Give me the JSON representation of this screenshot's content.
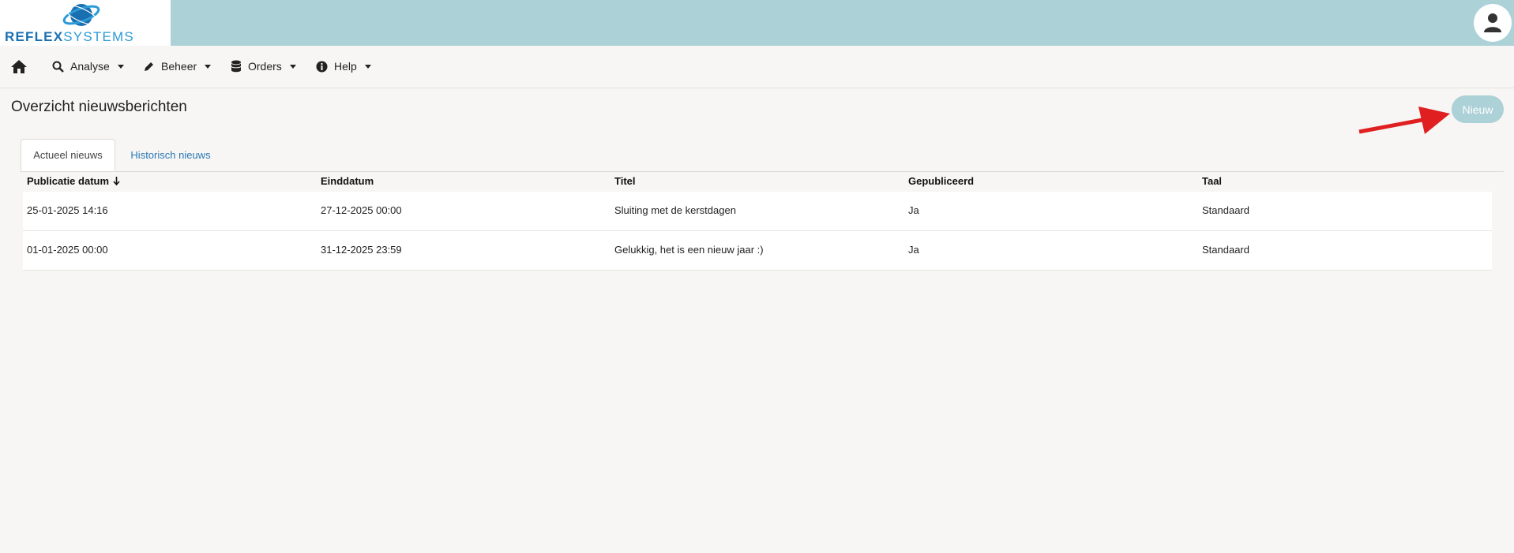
{
  "header": {
    "logo_text_bold": "REFLEX",
    "logo_text_light": "SYSTEMS",
    "colors": {
      "topbar": "#acd1d7",
      "logo_blue": "#1a6fb0",
      "logo_light_blue": "#2b9bd6"
    }
  },
  "nav": {
    "home_icon": "home-icon",
    "items": [
      {
        "label": "Analyse",
        "icon": "search-chart-icon"
      },
      {
        "label": "Beheer",
        "icon": "pencil-icon"
      },
      {
        "label": "Orders",
        "icon": "database-icon"
      },
      {
        "label": "Help",
        "icon": "info-icon"
      }
    ]
  },
  "page": {
    "title": "Overzicht nieuwsberichten",
    "new_button": "Nieuw"
  },
  "tabs": [
    {
      "label": "Actueel nieuws",
      "active": true
    },
    {
      "label": "Historisch nieuws",
      "active": false
    }
  ],
  "table": {
    "columns": [
      "Publicatie datum",
      "Einddatum",
      "Titel",
      "Gepubliceerd",
      "Taal"
    ],
    "rows": [
      [
        "25-01-2025 14:16",
        "27-12-2025 00:00",
        "Sluiting met de kerstdagen",
        "Ja",
        "Standaard"
      ],
      [
        "01-01-2025 00:00",
        "31-12-2025 23:59",
        "Gelukkig, het is een nieuw jaar :)",
        "Ja",
        "Standaard"
      ]
    ]
  }
}
